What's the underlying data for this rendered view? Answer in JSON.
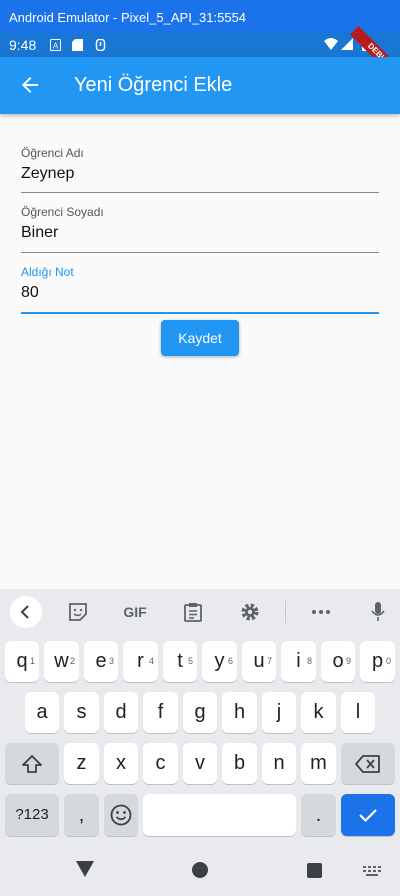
{
  "window": {
    "title": "Android Emulator - Pixel_5_API_31:5554"
  },
  "status_bar": {
    "time": "9:48",
    "debug_banner": "DEBUG"
  },
  "app_bar": {
    "title": "Yeni Öğrenci Ekle"
  },
  "form": {
    "first_name": {
      "label": "Öğrenci Adı",
      "value": "Zeynep"
    },
    "last_name": {
      "label": "Öğrenci Soyadı",
      "value": "Biner"
    },
    "grade": {
      "label": "Aldığı Not",
      "value": "80"
    },
    "save_label": "Kaydet"
  },
  "keyboard": {
    "toolbar_gif": "GIF",
    "row1": [
      "q",
      "w",
      "e",
      "r",
      "t",
      "y",
      "u",
      "i",
      "o",
      "p"
    ],
    "row1_hints": [
      "1",
      "2",
      "3",
      "4",
      "5",
      "6",
      "7",
      "8",
      "9",
      "0"
    ],
    "row2": [
      "a",
      "s",
      "d",
      "f",
      "g",
      "h",
      "j",
      "k",
      "l"
    ],
    "row3": [
      "z",
      "x",
      "c",
      "v",
      "b",
      "n",
      "m"
    ],
    "symbols_label": "?123",
    "comma": ",",
    "period": "."
  },
  "colors": {
    "primary": "#2196f3",
    "status_bar": "#1976d2",
    "keyboard_bg": "#e8eaed",
    "enter_key": "#1a73e8"
  }
}
